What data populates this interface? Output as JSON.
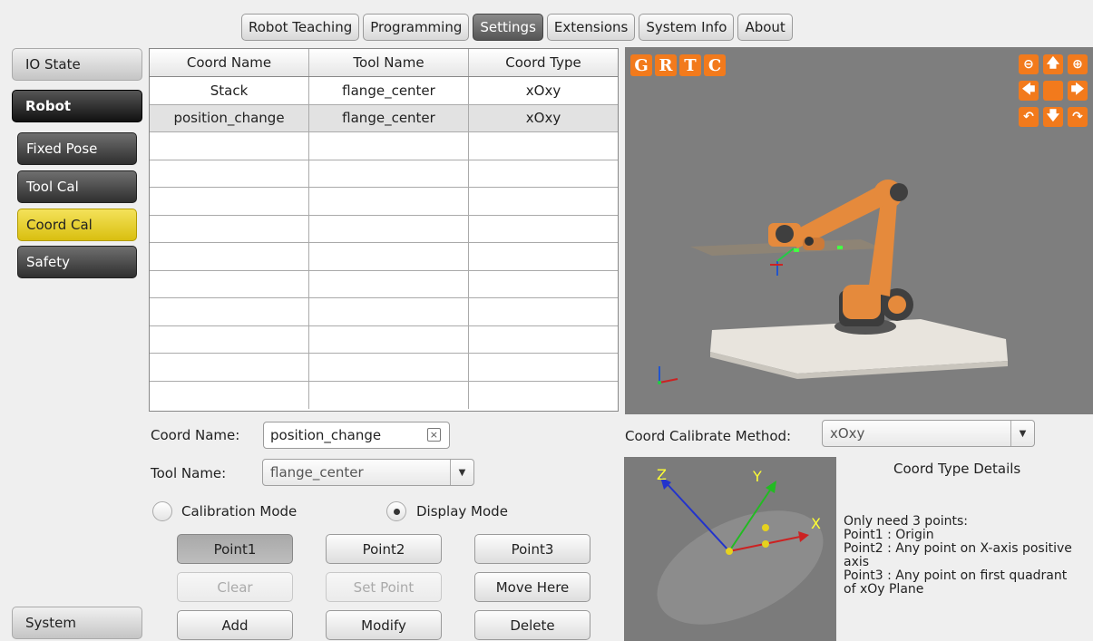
{
  "tabs": [
    "Robot Teaching",
    "Programming",
    "Settings",
    "Extensions",
    "System Info",
    "About"
  ],
  "active_tab": "Settings",
  "sidebar": {
    "io_state": "IO State",
    "robot": "Robot",
    "items": [
      "Fixed Pose",
      "Tool Cal",
      "Coord Cal",
      "Safety"
    ],
    "active_item": "Coord Cal",
    "system": "System"
  },
  "table": {
    "headers": [
      "Coord Name",
      "Tool Name",
      "Coord Type"
    ],
    "rows": [
      [
        "Stack",
        "flange_center",
        "xOxy"
      ],
      [
        "position_change",
        "flange_center",
        "xOxy"
      ]
    ],
    "selected_row": 1
  },
  "view_controls": {
    "letters": [
      "G",
      "R",
      "T",
      "C"
    ],
    "zoom_out": "−",
    "zoom_in": "+"
  },
  "form": {
    "coord_name_label": "Coord Name:",
    "coord_name_value": "position_change",
    "tool_name_label": "Tool Name:",
    "tool_name_value": "flange_center",
    "calibration_mode": "Calibration Mode",
    "display_mode": "Display Mode",
    "selected_mode": "Display Mode",
    "method_label": "Coord Calibrate Method:",
    "method_value": "xOxy"
  },
  "buttons": {
    "point1": "Point1",
    "point2": "Point2",
    "point3": "Point3",
    "clear": "Clear",
    "set_point": "Set Point",
    "move_here": "Move Here",
    "add": "Add",
    "modify": "Modify",
    "delete": "Delete"
  },
  "diagram": {
    "z": "Z",
    "y": "Y",
    "x": "X"
  },
  "details": {
    "title": "Coord Type Details",
    "lines": [
      "Only need 3 points:",
      "Point1 : Origin",
      "Point2 : Any point on X-axis positive axis",
      "Point3 : Any point on first quadrant of xOy Plane"
    ]
  },
  "colors": {
    "accent_orange": "#f27a1c",
    "active_yellow": "#e6cf2a",
    "view_bg": "#7e7e7e"
  }
}
